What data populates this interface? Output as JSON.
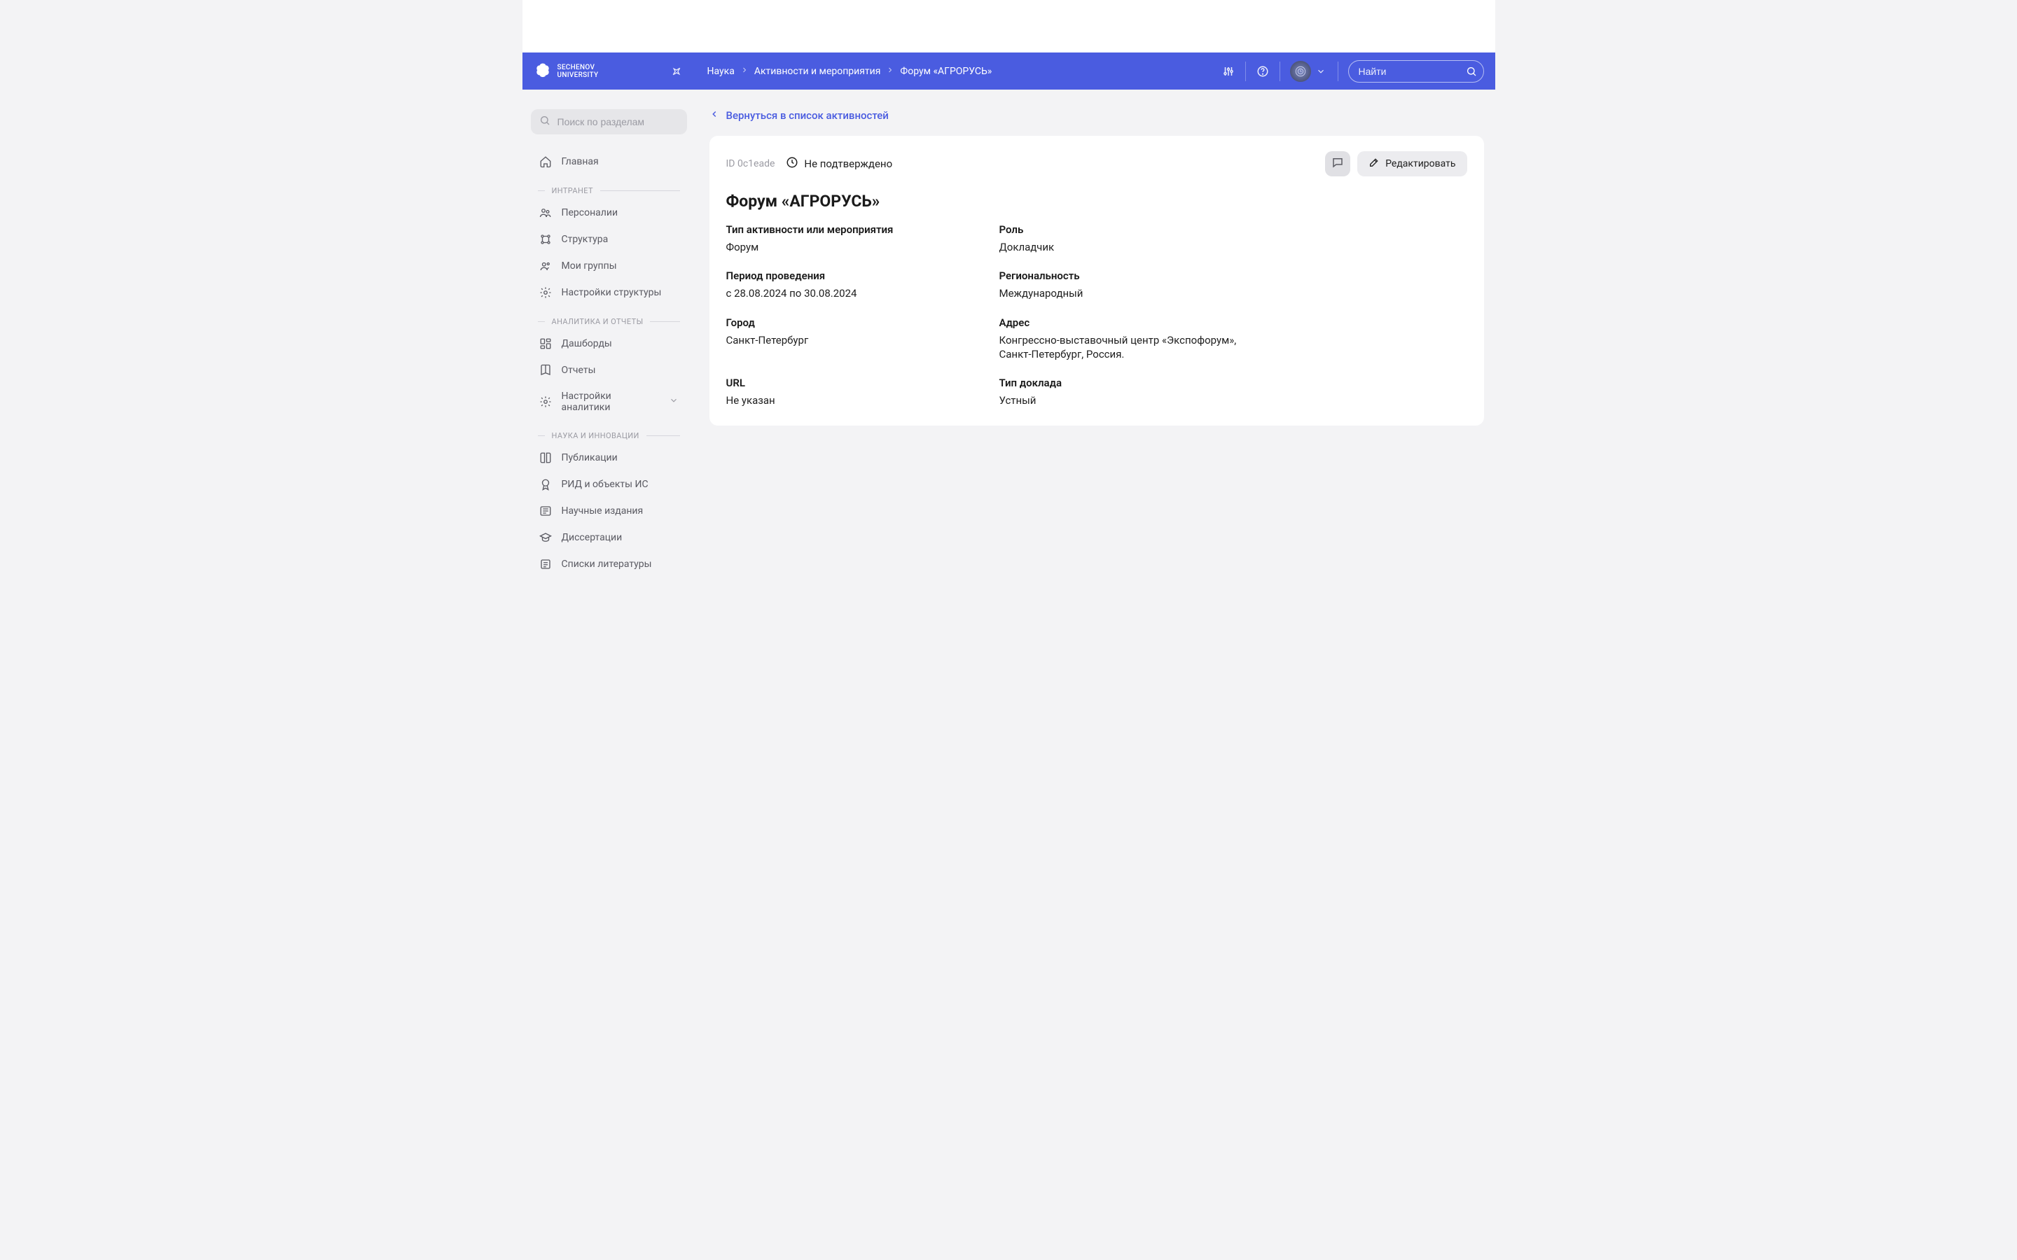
{
  "header": {
    "logo_line1": "Sechenov",
    "logo_line2": "University",
    "breadcrumbs": [
      "Наука",
      "Активности и мероприятия",
      "Форум «АГРОРУСЬ»"
    ],
    "search_placeholder": "Найти"
  },
  "sidebar": {
    "search_placeholder": "Поиск по разделам",
    "item_home": "Главная",
    "group_intranet": "ИНТРАНЕТ",
    "item_personalii": "Персоналии",
    "item_struktura": "Структура",
    "item_groups": "Мои группы",
    "item_struct_settings": "Настройки структуры",
    "group_analytics": "АНАЛИТИКА И ОТЧЕТЫ",
    "item_dashboards": "Дашборды",
    "item_reports": "Отчеты",
    "item_analytics_settings": "Настройки аналитики",
    "group_science": "НАУКА И ИННОВАЦИИ",
    "item_publications": "Публикации",
    "item_rid": "РИД и объекты ИС",
    "item_journals": "Научные издания",
    "item_dissertations": "Диссертации",
    "item_refs": "Списки литературы"
  },
  "content": {
    "back_link": "Вернуться в список активностей",
    "id_text": "ID 0c1eade",
    "status": "Не подтверждено",
    "edit_label": "Редактировать",
    "title": "Форум «АГРОРУСЬ»",
    "fields": {
      "type_label": "Тип активности или мероприятия",
      "type_value": "Форум",
      "role_label": "Роль",
      "role_value": "Докладчик",
      "period_label": "Период проведения",
      "period_value": "с 28.08.2024 по 30.08.2024",
      "regional_label": "Региональность",
      "regional_value": "Международный",
      "city_label": "Город",
      "city_value": "Санкт-Петербург",
      "address_label": "Адрес",
      "address_value": "Конгрессно-выставочный центр «Экспофорум», Санкт-Петербург, Россия.",
      "url_label": "URL",
      "url_value": "Не указан",
      "talk_type_label": "Тип доклада",
      "talk_type_value": "Устный"
    }
  }
}
